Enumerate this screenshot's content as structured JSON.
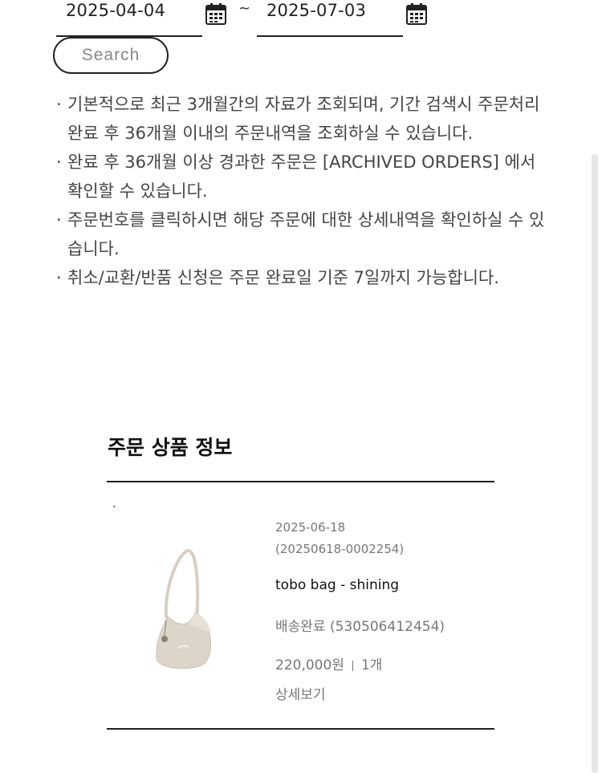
{
  "search": {
    "date_from": "2025-04-04",
    "date_to": "2025-07-03",
    "range_separator": "~",
    "button_label": "Search"
  },
  "notices": [
    "기본적으로 최근 3개월간의 자료가 조회되며, 기간 검색시 주문처리완료 후 36개월 이내의 주문내역을 조회하실 수 있습니다.",
    "완료 후 36개월 이상 경과한 주문은  [ARCHIVED ORDERS] 에서 확인할 수 있습니다.",
    "주문번호를 클릭하시면 해당 주문에 대한 상세내역을 확인하실 수 있습니다.",
    "취소/교환/반품 신청은 주문 완료일 기준 7일까지 가능합니다."
  ],
  "notice_bullet": "·",
  "orders_section": {
    "title": "주문 상품 정보",
    "marker": ".",
    "order": {
      "date": "2025-06-18",
      "order_number": "(20250618-0002254)",
      "product_name": "tobo bag - shining",
      "delivery_status": "배송완료 (530506412454)",
      "price": "220,000원",
      "quantity": "1개",
      "detail_link": "상세보기"
    }
  },
  "colors": {
    "text": "#222222",
    "muted": "#777777",
    "bag": "#ddd5c9"
  },
  "icons": {
    "calendar": "calendar-icon"
  }
}
